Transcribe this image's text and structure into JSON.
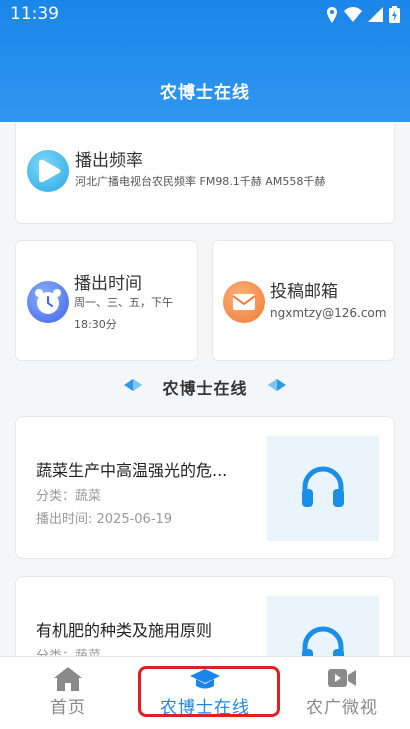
{
  "status_bar": {
    "time": "11:39"
  },
  "header": {
    "title": "农博士在线"
  },
  "radio_card": {
    "title": "播出频率",
    "subtitle": "河北广播电视台农民频率   FM98.1千赫   AM558千赫",
    "icon": "radio-play-icon"
  },
  "time_card": {
    "title": "播出时间",
    "line1": "周一、三、五，下午",
    "line2": "18:30分",
    "icon": "alarm-clock-icon"
  },
  "mail_card": {
    "title": "投稿邮箱",
    "email": "ngxmtzy@126.com",
    "icon": "mail-icon"
  },
  "section": {
    "title": "农博士在线"
  },
  "articles": [
    {
      "title": "蔬菜生产中高温强光的危...",
      "category": "分类：蔬菜",
      "air_time": "播出时间: 2025-06-19",
      "thumb_icon": "headphones-icon"
    },
    {
      "title": "有机肥的种类及施用原则",
      "category": "分类：蔬菜",
      "thumb_icon": "headphones-icon"
    }
  ],
  "bottom_nav": {
    "items": [
      {
        "label": "首页",
        "icon": "home-icon"
      },
      {
        "label": "农博士在线",
        "icon": "graduation-cap-icon",
        "active": true
      },
      {
        "label": "农广微视",
        "icon": "video-camera-icon"
      }
    ]
  },
  "colors": {
    "primary": "#1b86e9",
    "highlight": "#e02020"
  }
}
